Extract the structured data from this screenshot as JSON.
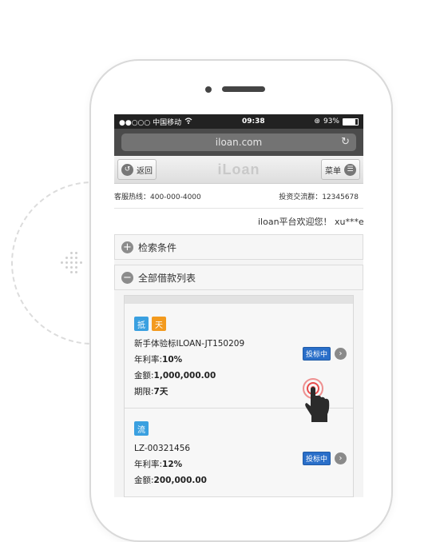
{
  "status": {
    "carrier": "●●○○○ 中国移动",
    "time": "09:38",
    "battery": "93%",
    "icons": [
      "wifi-icon",
      "lock-rotation-icon",
      "battery-icon"
    ]
  },
  "browser": {
    "url": "iloan.com"
  },
  "nav": {
    "back_label": "返回",
    "logo": "iLoan",
    "menu_label": "菜单"
  },
  "contact": {
    "hotline": "客服热线：400-000-4000",
    "group": "投资交流群：12345678"
  },
  "marquee": {
    "text": "iloan平台欢迎您！ xu***en"
  },
  "panels": {
    "search": "检索条件",
    "list": "全部借款列表"
  },
  "loans": [
    {
      "tags": [
        {
          "text": "抵",
          "color": "#3aa0e0"
        },
        {
          "text": "天",
          "color": "#f39a1e"
        }
      ],
      "title": "新手体验标ILOAN-JT150209",
      "rate_label": "年利率:",
      "rate": "10%",
      "amount_label": "金额:",
      "amount": "1,000,000.00",
      "term_label": "期限:",
      "term": "7天",
      "bid_label": "投标中"
    },
    {
      "tags": [
        {
          "text": "流",
          "color": "#3aa0e0"
        }
      ],
      "title": "LZ-00321456",
      "rate_label": "年利率:",
      "rate": "12%",
      "amount_label": "金额:",
      "amount": "200,000.00",
      "bid_label": "投标中"
    }
  ],
  "colors": {
    "bid_blue": "#2a6fc9",
    "tag_blue": "#3aa0e0",
    "tag_orange": "#f39a1e",
    "tap_red": "#e84b4b"
  }
}
